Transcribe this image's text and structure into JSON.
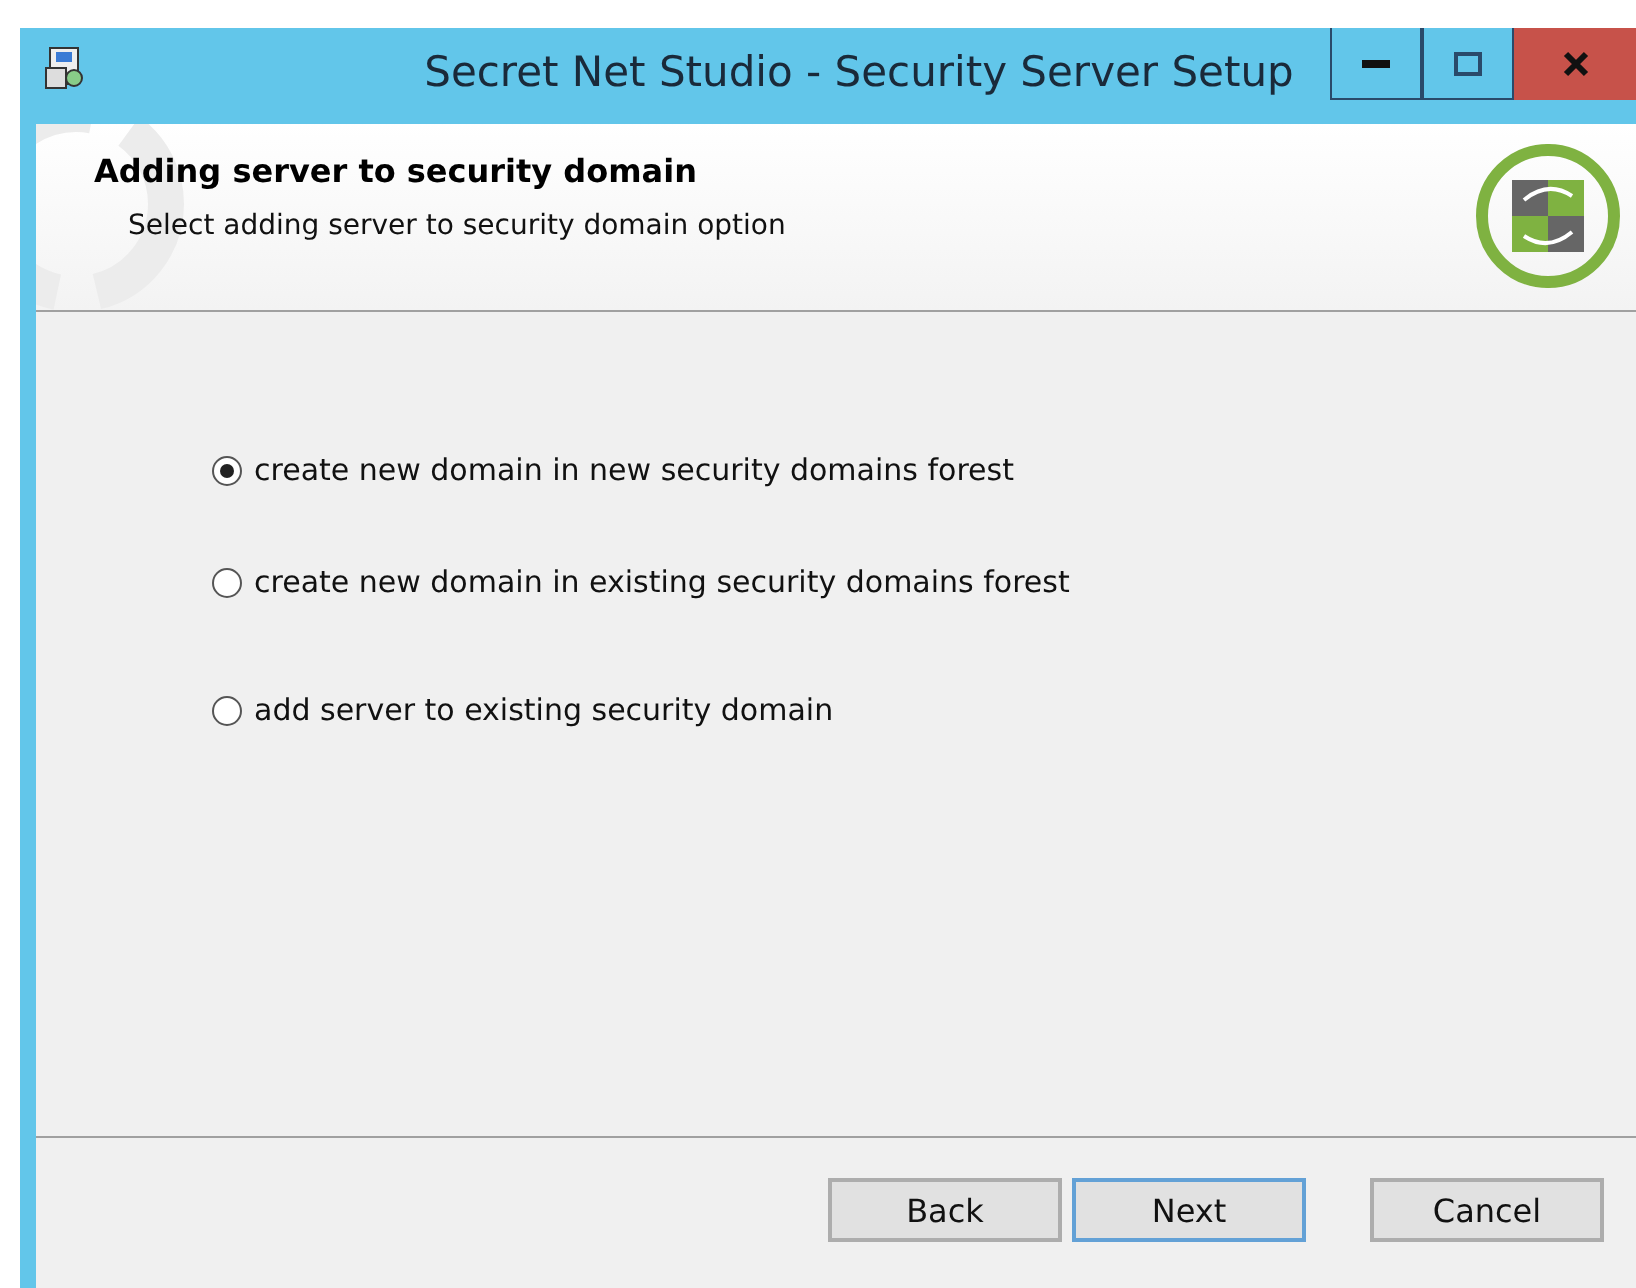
{
  "window": {
    "title": "Secret Net Studio - Security Server Setup"
  },
  "header": {
    "title": "Adding server to security domain",
    "subtitle": "Select adding server to security domain option"
  },
  "options": [
    {
      "label": "create new domain in new security domains forest",
      "selected": true
    },
    {
      "label": "create new domain in existing security domains forest",
      "selected": false
    },
    {
      "label": "add server to existing security domain",
      "selected": false
    }
  ],
  "buttons": [
    {
      "label": "Back",
      "focused": false
    },
    {
      "label": "Next",
      "focused": true
    },
    {
      "label": "Cancel",
      "focused": false
    }
  ]
}
